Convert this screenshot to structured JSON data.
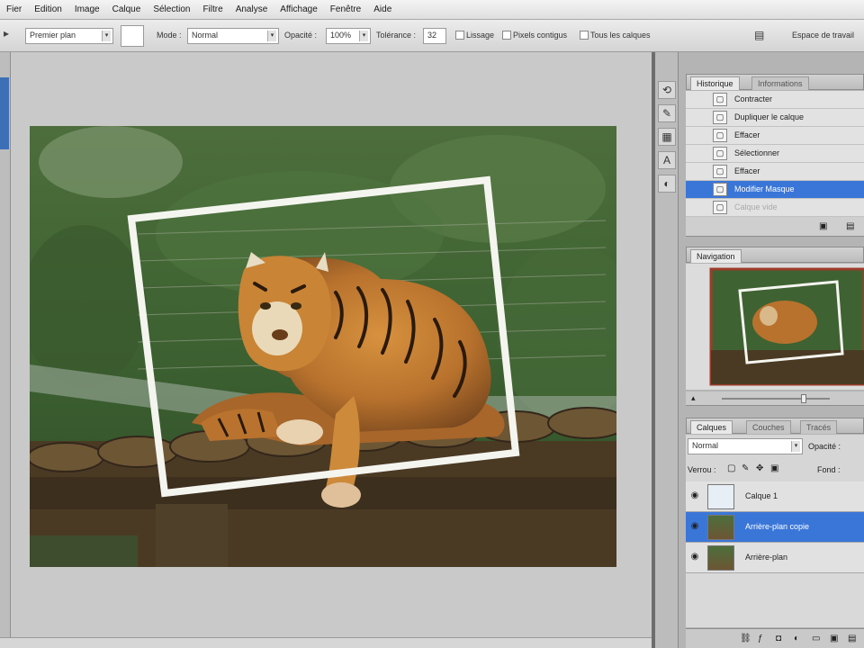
{
  "menu": [
    "Fier",
    "Edition",
    "Image",
    "Calque",
    "Sélection",
    "Filtre",
    "Analyse",
    "Affichage",
    "Fenêtre",
    "Aide"
  ],
  "options": {
    "sample_select": "Premier plan",
    "mode_label": "Mode :",
    "mode_value": "Normal",
    "opacity_label": "Opacité :",
    "opacity_value": "100%",
    "tolerance_label": "Tolérance :",
    "tolerance_value": "32",
    "lissage_label": "Lissage",
    "contiguous_label": "Pixels contigus",
    "all_layers_label": "Tous les calques",
    "workspace_label": "Espace de travail"
  },
  "history": {
    "tabs": [
      "Historique",
      "Informations"
    ],
    "items": [
      {
        "label": "Contracter",
        "state": "normal"
      },
      {
        "label": "Dupliquer le calque",
        "state": "normal"
      },
      {
        "label": "Effacer",
        "state": "normal"
      },
      {
        "label": "Sélectionner",
        "state": "normal"
      },
      {
        "label": "Effacer",
        "state": "normal"
      },
      {
        "label": "Modifier Masque",
        "state": "selected"
      },
      {
        "label": "Calque vide",
        "state": "faded"
      }
    ]
  },
  "navigator": {
    "tabs": [
      "Navigation"
    ]
  },
  "layers": {
    "tabs": [
      "Calques",
      "Couches",
      "Tracés"
    ],
    "blend_mode": "Normal",
    "opacity_label": "Opacité :",
    "lock_label": "Verrou :",
    "fill_label": "Fond :",
    "items": [
      {
        "label": "Calque 1",
        "state": "normal",
        "thumb": "blank"
      },
      {
        "label": "Arrière-plan copie",
        "state": "selected",
        "thumb": "tiger"
      },
      {
        "label": "Arrière-plan",
        "state": "normal",
        "thumb": "tiger"
      }
    ]
  },
  "colors": {
    "selection_blue": "#3a76d8",
    "frame_white": "#f5f5f0"
  }
}
